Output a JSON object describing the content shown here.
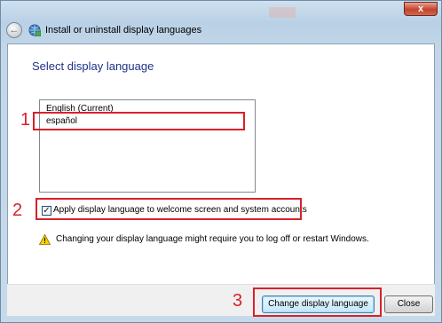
{
  "window": {
    "title": "Install or uninstall display languages",
    "close_glyph": "x"
  },
  "page": {
    "heading": "Select display language"
  },
  "language_list": {
    "items": [
      "English (Current)",
      "español"
    ],
    "selected": "español"
  },
  "option": {
    "apply_welcome_label": "Apply display language to welcome screen and system accounts",
    "checked": true
  },
  "warning": {
    "text": "Changing your display language might require you to log off or restart Windows.",
    "icon": "warning-icon"
  },
  "buttons": {
    "change_label": "Change display language",
    "close_label": "Close"
  },
  "annotations": {
    "labels": [
      "1",
      "2",
      "3"
    ],
    "color": "#d9212a"
  }
}
